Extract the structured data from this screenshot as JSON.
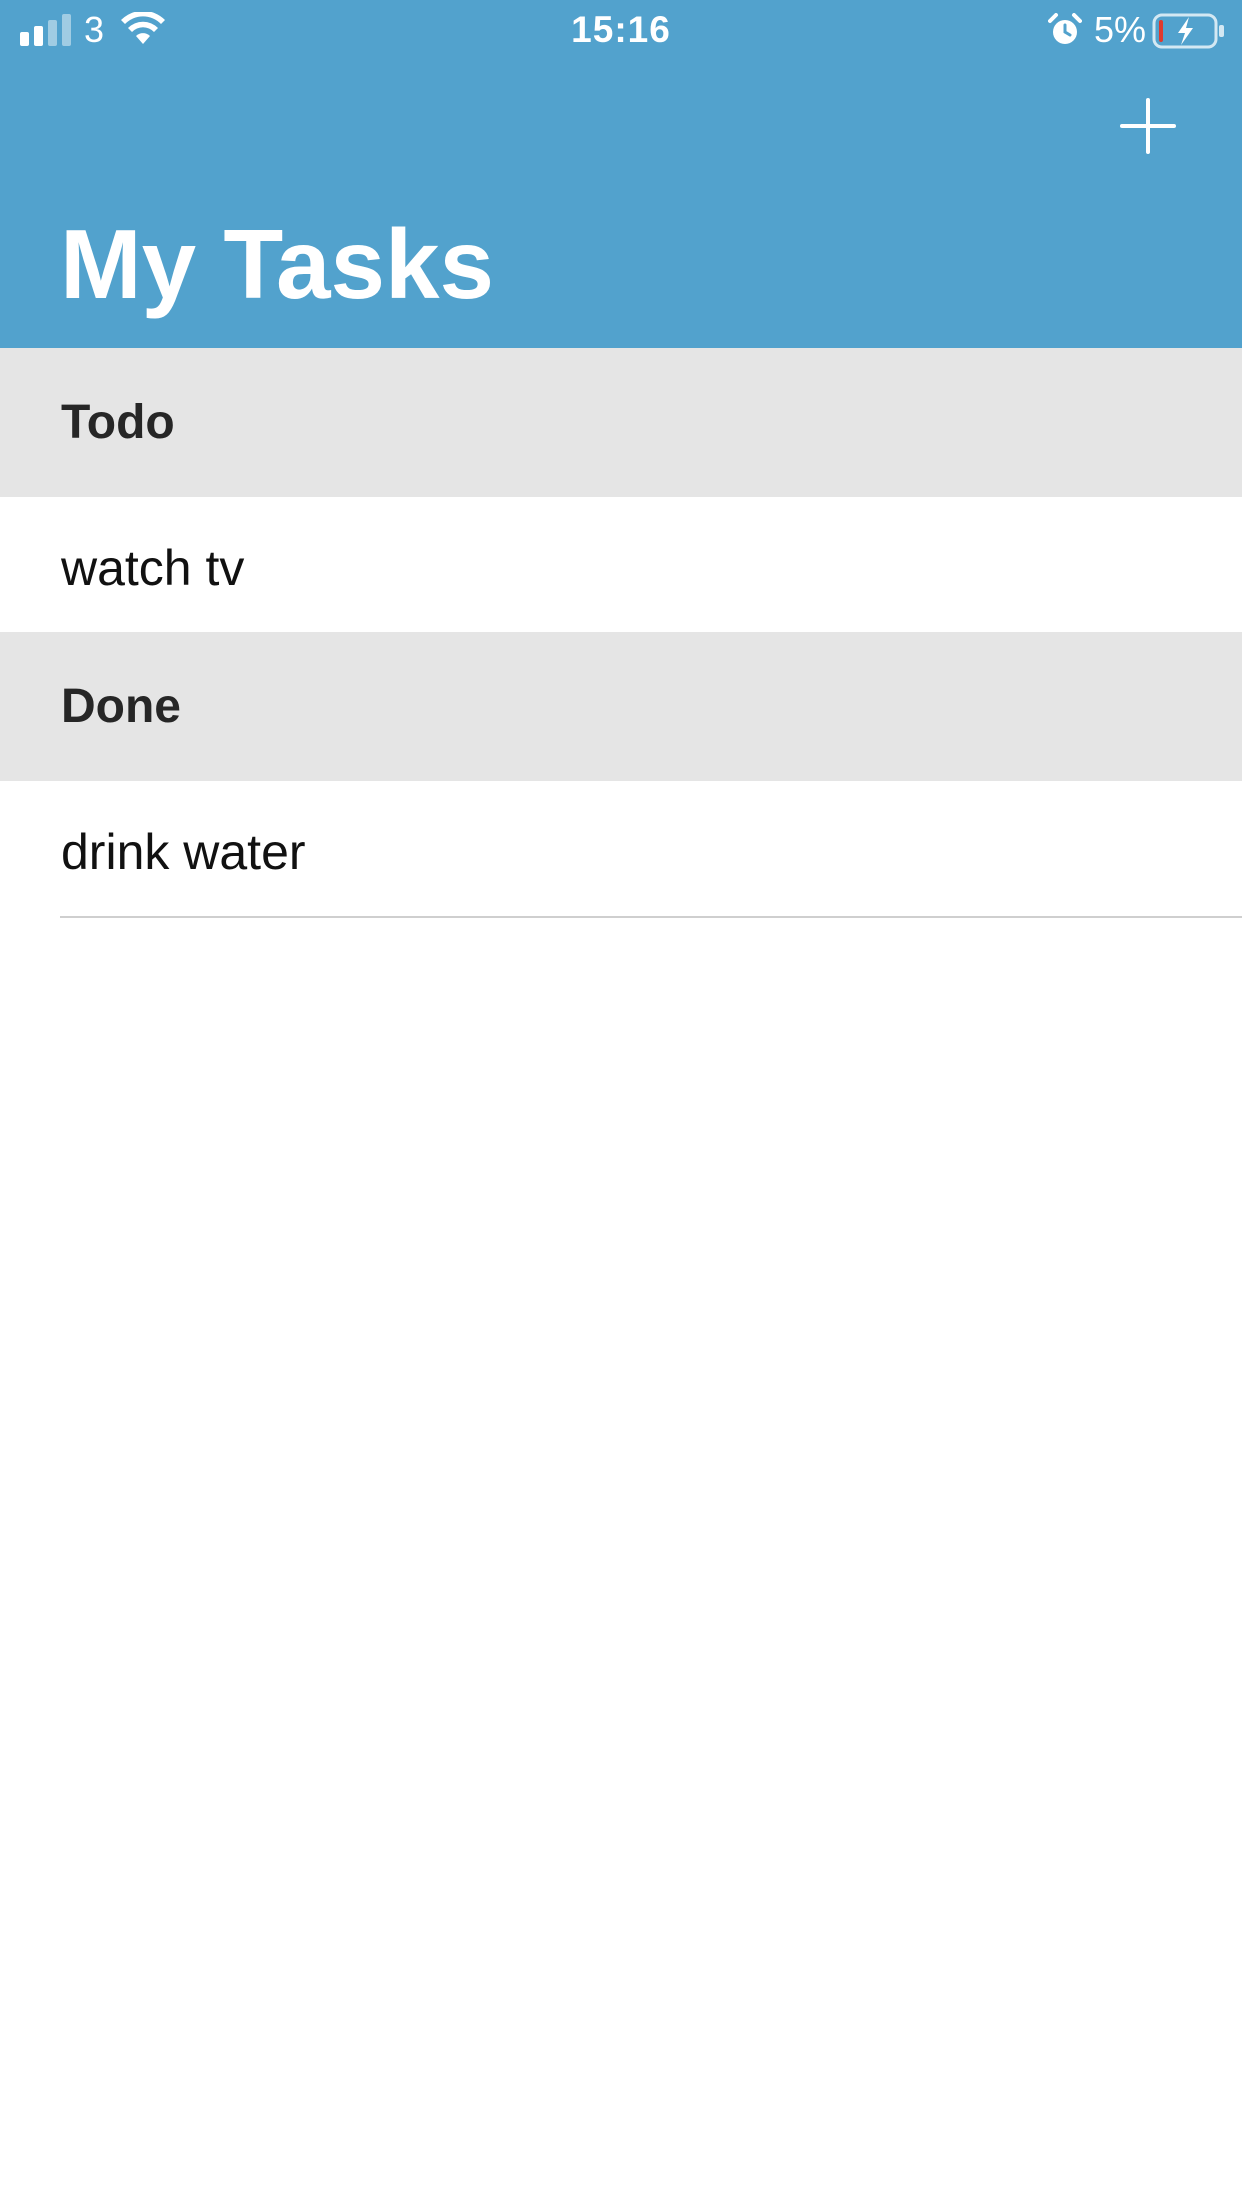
{
  "status_bar": {
    "carrier": "3",
    "time": "15:16",
    "battery_percent": "5%",
    "signal_bars": 2,
    "signal_bars_total": 4,
    "battery_level": 0.05,
    "charging": true,
    "icons": [
      "signal-icon",
      "wifi-icon",
      "alarm-icon",
      "battery-icon"
    ]
  },
  "header": {
    "title": "My Tasks",
    "add_icon": "plus-icon"
  },
  "sections": [
    {
      "title": "Todo",
      "tasks": [
        "watch tv"
      ]
    },
    {
      "title": "Done",
      "tasks": [
        "drink water"
      ]
    }
  ],
  "colors": {
    "header_background": "#52a2cd",
    "section_background": "#e5e5e5",
    "battery_low": "#e03a2e"
  }
}
